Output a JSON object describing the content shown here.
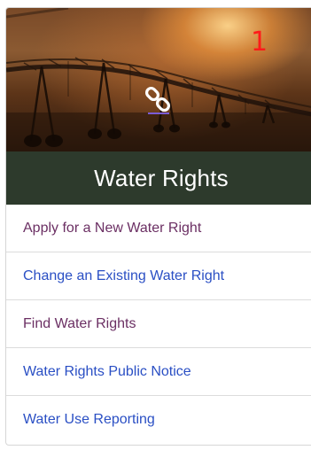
{
  "hero": {
    "badge_number": "1",
    "icon": "link-icon"
  },
  "card": {
    "title": "Water Rights"
  },
  "links": [
    {
      "label": "Apply for a New Water Right",
      "state": "visited"
    },
    {
      "label": "Change an Existing Water Right",
      "state": "unvisited"
    },
    {
      "label": "Find Water Rights",
      "state": "visited"
    },
    {
      "label": "Water Rights Public Notice",
      "state": "unvisited"
    },
    {
      "label": "Water Use Reporting",
      "state": "unvisited"
    }
  ],
  "colors": {
    "title_bar": "#2d3a2c",
    "visited_link": "#6b2f63",
    "unvisited_link": "#2a4fc4",
    "badge": "#ff1a1a"
  }
}
